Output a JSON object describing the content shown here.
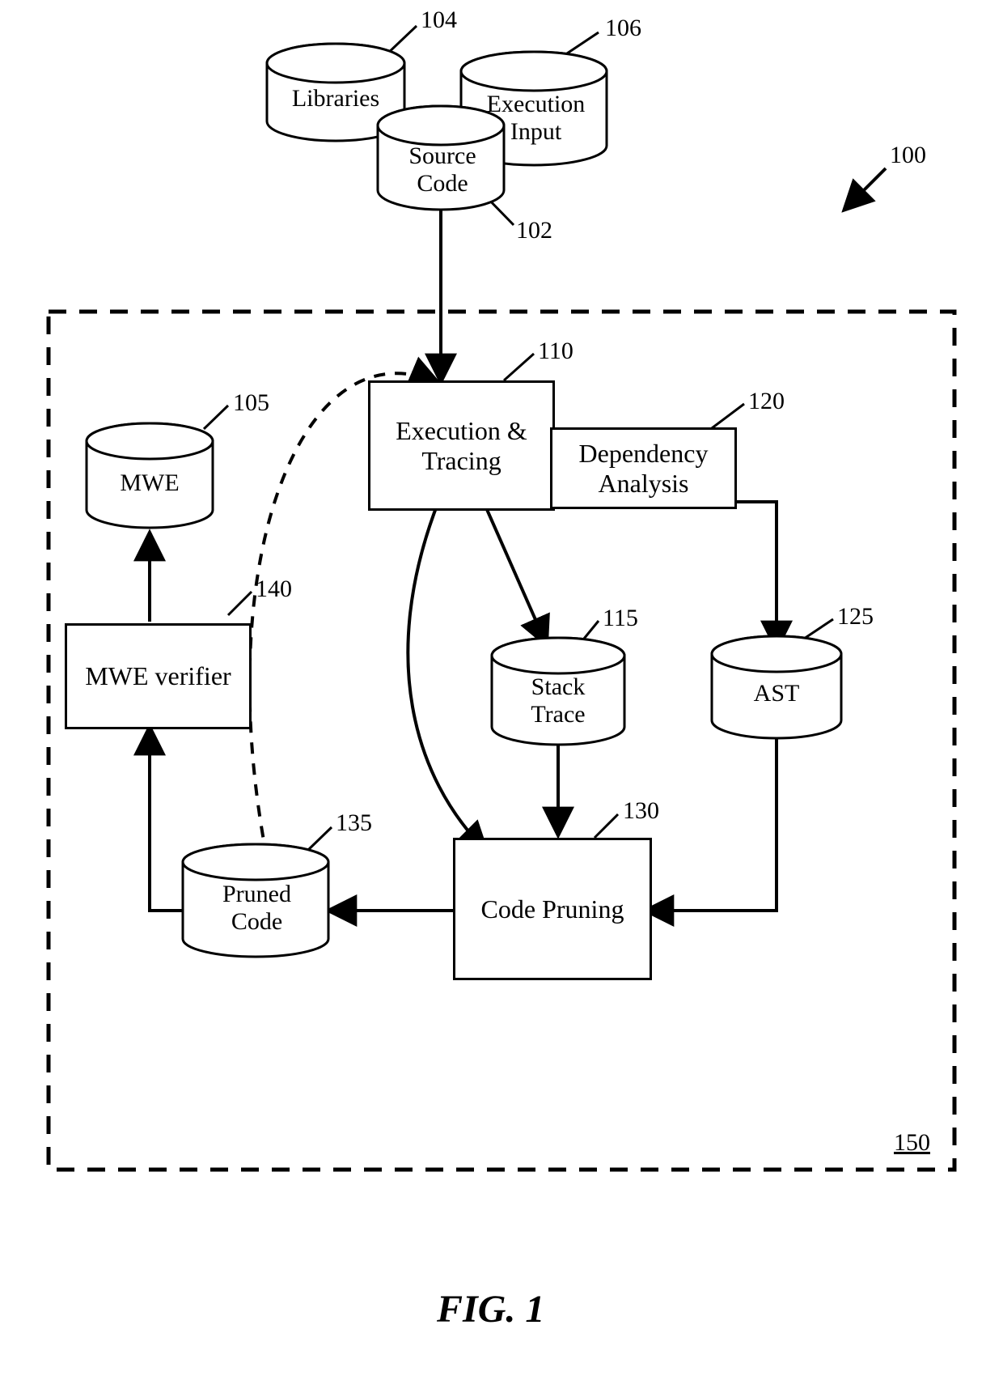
{
  "figure": {
    "caption": "FIG. 1",
    "system_ref": "100",
    "container_ref": "150"
  },
  "nodes": {
    "libraries": {
      "label": "Libraries",
      "ref": "104"
    },
    "exec_input": {
      "label": "Execution\nInput",
      "ref": "106"
    },
    "source": {
      "label": "Source\nCode",
      "ref": "102"
    },
    "exec_trace": {
      "label": "Execution &\nTracing",
      "ref": "110"
    },
    "dep": {
      "label": "Dependency\nAnalysis",
      "ref": "120"
    },
    "stack": {
      "label": "Stack\nTrace",
      "ref": "115"
    },
    "ast": {
      "label": "AST",
      "ref": "125"
    },
    "prune": {
      "label": "Code Pruning",
      "ref": "130"
    },
    "pruned": {
      "label": "Pruned\nCode",
      "ref": "135"
    },
    "verifier": {
      "label": "MWE verifier",
      "ref": "140"
    },
    "mwe": {
      "label": "MWE",
      "ref": "105"
    }
  },
  "edges": [
    {
      "from": "source",
      "to": "exec_trace",
      "style": "solid",
      "head": "arrow"
    },
    {
      "from": "exec_trace",
      "to": "stack",
      "style": "solid",
      "head": "arrow"
    },
    {
      "from": "exec_trace",
      "to": "prune",
      "style": "solid",
      "head": "arrow",
      "shape": "curve"
    },
    {
      "from": "dep",
      "to": "ast",
      "style": "solid",
      "head": "arrow"
    },
    {
      "from": "stack",
      "to": "prune",
      "style": "solid",
      "head": "arrow"
    },
    {
      "from": "ast",
      "to": "prune",
      "style": "solid",
      "head": "arrow"
    },
    {
      "from": "prune",
      "to": "pruned",
      "style": "solid",
      "head": "arrow"
    },
    {
      "from": "pruned",
      "to": "verifier",
      "style": "solid",
      "head": "arrow"
    },
    {
      "from": "verifier",
      "to": "mwe",
      "style": "solid",
      "head": "arrow"
    },
    {
      "from": "pruned",
      "to": "exec_trace",
      "style": "dashed",
      "head": "arrow",
      "shape": "curve",
      "note": "feedback loop"
    }
  ]
}
